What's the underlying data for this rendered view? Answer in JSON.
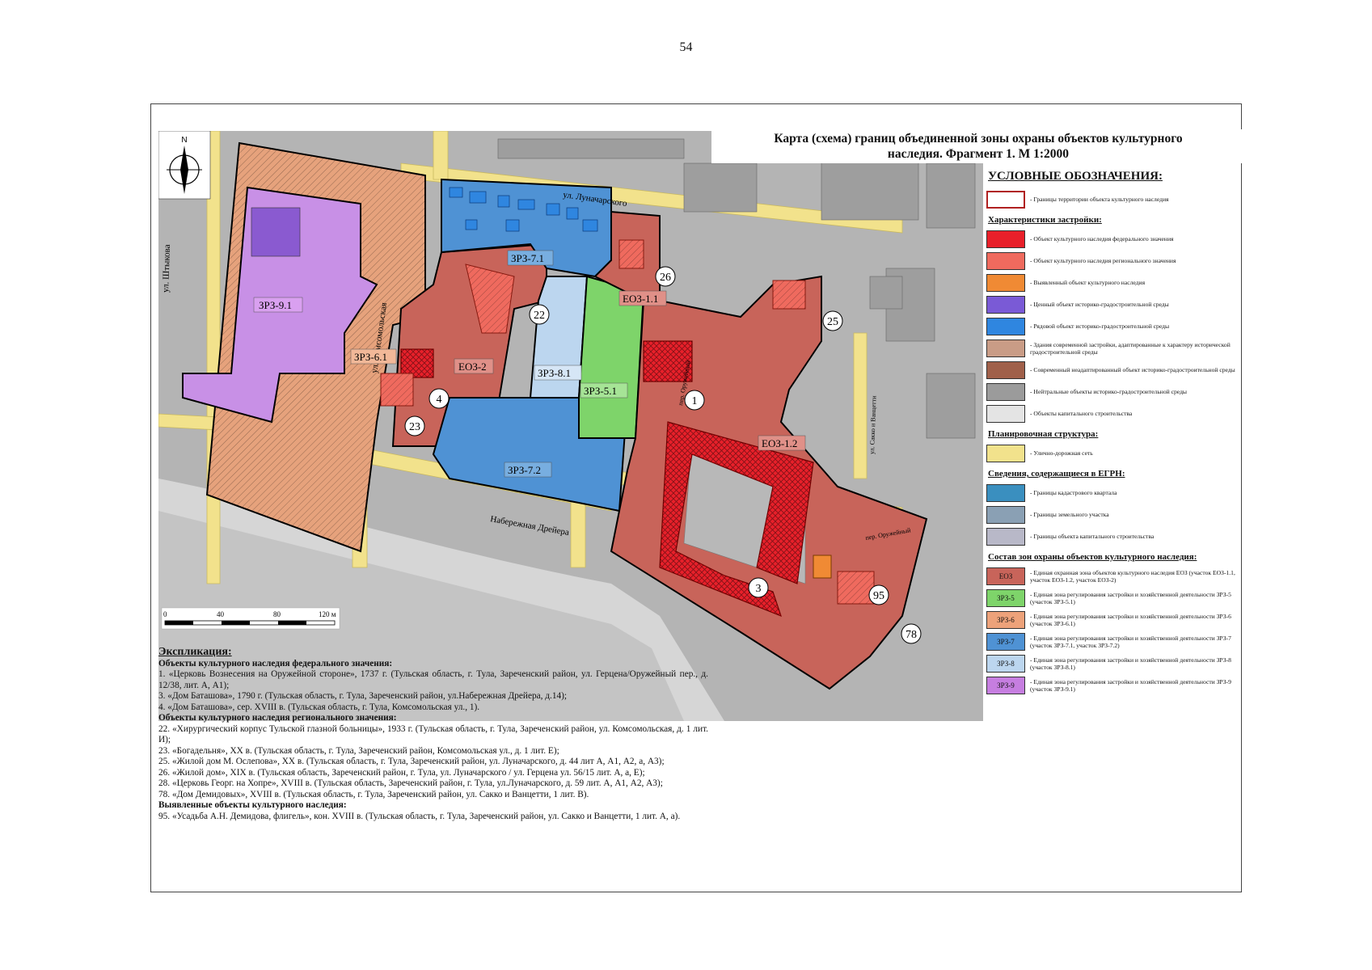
{
  "page_number": "54",
  "title_line1": "Карта (схема) границ объединенной зоны охраны объектов культурного",
  "title_line2": "наследия. Фрагмент 1. М 1:2000",
  "legend": {
    "heading": "УСЛОВНЫЕ ОБОЗНАЧЕНИЯ:",
    "boundary_label": "- Границы территории объекта культурного наследия",
    "section_buildings": "Характеристики застройки:",
    "buildings": [
      {
        "label": "- Объект культурного наследия федерального значения",
        "color": "#e8202a"
      },
      {
        "label": "- Объект культурного наследия регионального значения",
        "color": "#ef6a5e"
      },
      {
        "label": "- Выявленный объект культурного наследия",
        "color": "#f08a34"
      },
      {
        "label": "- Ценный объект историко-градостроительной среды",
        "color": "#7a5ad6"
      },
      {
        "label": "- Рядовой объект историко-градостроительной среды",
        "color": "#2f86e0"
      },
      {
        "label": "- Здания современной застройки, адаптированные к характеру исторической градостроительной среды",
        "color": "#c99c86"
      },
      {
        "label": "- Современный неадаптированный объект историко-градостроительной среды",
        "color": "#a0604a"
      },
      {
        "label": "- Нейтральные объекты историко-градостроительной среды",
        "color": "#9b9b9b"
      },
      {
        "label": "- Объекты капитального строительства",
        "color": "#e4e4e4"
      }
    ],
    "section_planning": "Планировочная структура:",
    "road_label": "- Улично-дорожная сеть",
    "road_color": "#f2e28c",
    "section_egrn": "Сведения, содержащиеся в ЕГРН:",
    "egrn": [
      {
        "label": "- Границы кадастрового квартала",
        "color": "#3a8fbf"
      },
      {
        "label": "- Границы земельного участка",
        "color": "#8aa0b4"
      },
      {
        "label": "- Границы объекта капитального строительства",
        "color": "#b8b8c8"
      }
    ],
    "section_zones": "Состав зон охраны объектов культурного наследия:",
    "zones": [
      {
        "code": "ЕОЗ",
        "label": "- Единая охранная зона объектов культурного наследия ЕОЗ (участок ЕОЗ-1.1, участок ЕОЗ-1.2, участок ЕОЗ-2)",
        "color": "#c8645a"
      },
      {
        "code": "ЗРЗ-5",
        "label": "- Единая зона регулирования застройки и хозяйственной деятельности ЗРЗ-5 (участок ЗРЗ-5.1)",
        "color": "#7ed46a"
      },
      {
        "code": "ЗРЗ-6",
        "label": "- Единая зона регулирования застройки и хозяйственной деятельности ЗРЗ-6 (участок ЗРЗ-6.1)",
        "color": "#eda27a"
      },
      {
        "code": "ЗРЗ-7",
        "label": "- Единая зона регулирования застройки и хозяйственной деятельности ЗРЗ-7 (участок ЗРЗ-7.1, участок ЗРЗ-7.2)",
        "color": "#4f92d4"
      },
      {
        "code": "ЗРЗ-8",
        "label": "- Единая зона регулирования застройки и хозяйственной деятельности ЗРЗ-8 (участок ЗРЗ-8.1)",
        "color": "#bcd6ef"
      },
      {
        "code": "ЗРЗ-9",
        "label": "- Единая зона регулирования застройки и хозяйственной деятельности ЗРЗ-9 (участок ЗРЗ-9.1)",
        "color": "#c67ee0"
      }
    ]
  },
  "map": {
    "north_label": "N",
    "scale_labels": [
      "0",
      "40",
      "80",
      "120 м"
    ],
    "streets": {
      "lunacharskogo": "ул. Луначарского",
      "shtykova": "ул. Штыкова",
      "komsomolskaya": "ул. Комсомольская",
      "naberezhnaya": "Набережная Дрейера",
      "oruzheyny1": "пер. Оружейный",
      "oruzheyny2": "пер. Оружейный",
      "sacco": "ул. Сакко и Ванцетти"
    },
    "zone_labels": {
      "z91": "ЗРЗ-9.1",
      "z61": "ЗРЗ-6.1",
      "z71": "ЗРЗ-7.1",
      "z72": "ЗРЗ-7.2",
      "z81": "ЗРЗ-8.1",
      "z51": "ЗРЗ-5.1",
      "e11": "ЕОЗ-1.1",
      "e12": "ЕОЗ-1.2",
      "e2": "ЕОЗ-2"
    },
    "objects": {
      "o1": "1",
      "o3": "3",
      "o4": "4",
      "o22": "22",
      "o23": "23",
      "o25": "25",
      "o26": "26",
      "o78": "78",
      "o95": "95"
    }
  },
  "explication": {
    "heading": "Экспликация:",
    "sec_federal": "Объекты культурного наследия федерального значения:",
    "federal": [
      "1. «Церковь Вознесения на Оружейной стороне», 1737 г. (Тульская область, г. Тула, Зареченский район, ул. Герцена/Оружейный пер., д. 12/38, лит. А, А1);",
      "3. «Дом Баташова», 1790 г. (Тульская область, г. Тула, Зареченский район, ул.Набережная Дрейера, д.14);",
      "4. «Дом Баташова», сер. XVIII в. (Тульская область, г. Тула, Комсомольская ул., 1)."
    ],
    "sec_regional": "Объекты культурного наследия регионального значения:",
    "regional": [
      "22. «Хирургический корпус Тульской глазной больницы», 1933 г. (Тульская область, г. Тула, Зареченский район, ул. Комсомольская, д. 1 лит. И);",
      "23. «Богадельня», XX в. (Тульская область, г. Тула, Зареченский район, Комсомольская ул., д. 1 лит. Е);",
      "25. «Жилой дом М. Ослепова», XX в. (Тульская область, г. Тула, Зареченский район, ул. Луначарского, д. 44 лит А, А1, А2, а, А3);",
      "26. «Жилой дом», XIX в. (Тульская область, Зареченский район, г. Тула, ул. Луначарского / ул. Герцена ул. 56/15 лит. А, а, Е);",
      "28. «Церковь Георг. на Хопре», XVIII в. (Тульская область, Зареченский район, г. Тула, ул.Луначарского, д. 59 лит. А, А1, А2, А3);",
      "78. «Дом Демидовых», XVIII в. (Тульская область, г. Тула, Зареченский район, ул. Сакко и Ванцетти, 1 лит. В)."
    ],
    "sec_identified": "Выявленные объекты культурного наследия:",
    "identified": [
      "95. «Усадьба А.Н. Демидова, флигель», кон. XVIII в. (Тульская область, г. Тула, Зареченский район, ул. Сакко и Ванцетти, 1 лит. А, а)."
    ]
  }
}
